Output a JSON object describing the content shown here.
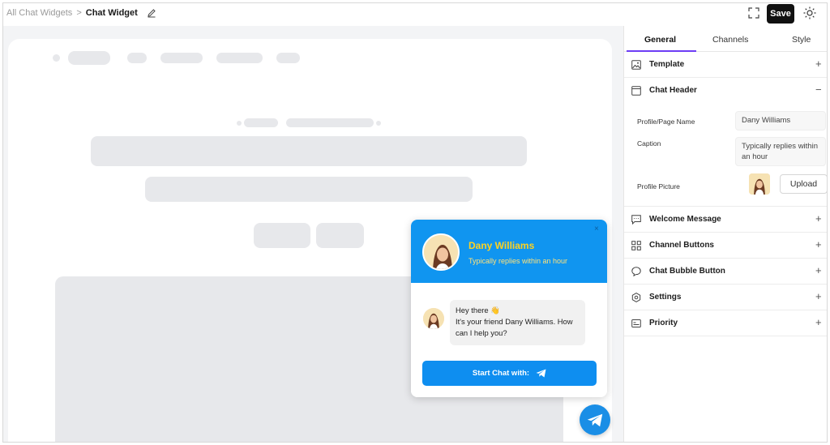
{
  "breadcrumb": {
    "parent": "All Chat Widgets",
    "separator": ">",
    "current": "Chat Widget"
  },
  "toolbar": {
    "save_label": "Save"
  },
  "icons": {
    "edit": "pencil-icon",
    "fullscreen": "fullscreen-icon",
    "theme": "sun-icon",
    "close": "close-icon",
    "telegram": "telegram-icon"
  },
  "widget": {
    "name": "Dany Williams",
    "caption": "Typically replies within an hour",
    "close_glyph": "×",
    "message_line1": "Hey there 👋",
    "message_line2": "It's your friend Dany Williams. How can I help you?",
    "start_label": "Start Chat with:",
    "colors": {
      "header": "#1095f0",
      "name": "#ffd21f",
      "button": "#0e8ef0"
    }
  },
  "panel": {
    "tabs": [
      {
        "label": "General",
        "active": true
      },
      {
        "label": "Channels",
        "active": false
      },
      {
        "label": "Style",
        "active": false
      }
    ],
    "accent": "#6d3df5",
    "sections": {
      "template": {
        "label": "Template",
        "toggle": "+",
        "icon": "image-icon"
      },
      "chat_header": {
        "label": "Chat Header",
        "toggle": "−",
        "icon": "window-icon"
      },
      "welcome": {
        "label": "Welcome Message",
        "toggle": "+",
        "icon": "message-icon"
      },
      "channel_buttons": {
        "label": "Channel Buttons",
        "toggle": "+",
        "icon": "grid-icon"
      },
      "bubble": {
        "label": "Chat Bubble Button",
        "toggle": "+",
        "icon": "bubble-icon"
      },
      "settings": {
        "label": "Settings",
        "toggle": "+",
        "icon": "gear-icon"
      },
      "priority": {
        "label": "Priority",
        "toggle": "+",
        "icon": "priority-icon"
      }
    },
    "chat_header_fields": {
      "profile_name_label": "Profile/Page Name",
      "profile_name_value": "Dany Williams",
      "caption_label": "Caption",
      "caption_value": "Typically replies within an hour",
      "picture_label": "Profile Picture",
      "upload_label": "Upload"
    }
  }
}
